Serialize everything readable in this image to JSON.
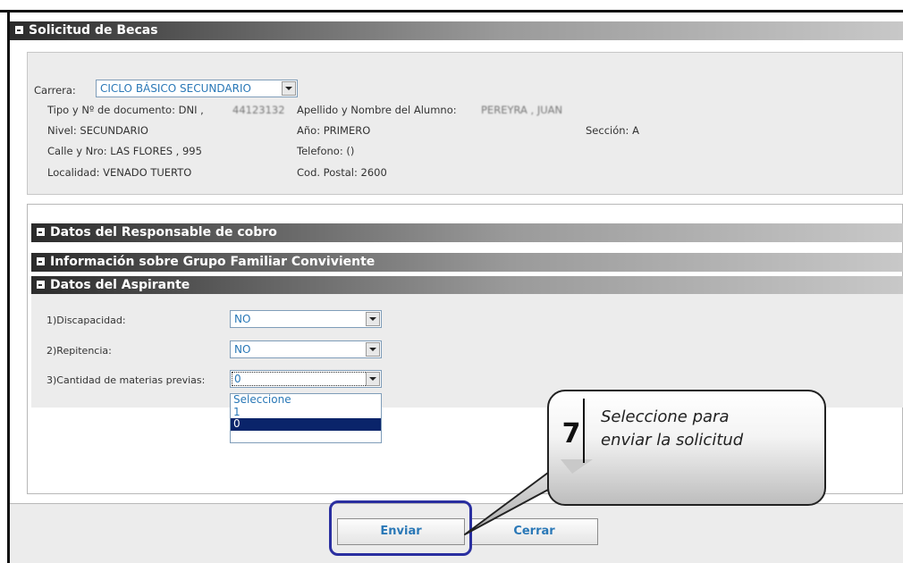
{
  "window": {
    "title": "Solicitud de Becas"
  },
  "student": {
    "carrera_label": "Carrera:",
    "carrera_value": "CICLO BÁSICO SECUNDARIO",
    "doc_label": "Tipo y Nº de documento: DNI ,",
    "doc_number": "44123132",
    "name_label": "Apellido y Nombre del Alumno:",
    "name_value": "PEREYRA , JUAN",
    "nivel": "Nivel: SECUNDARIO",
    "anio": "Año: PRIMERO",
    "seccion": "Sección: A",
    "calle": "Calle y Nro: LAS FLORES , 995",
    "telefono": "Telefono: ()",
    "localidad": "Localidad: VENADO TUERTO",
    "cod_postal": "Cod. Postal: 2600"
  },
  "sections": {
    "responsable": "Datos del Responsable de cobro",
    "grupo_familiar": "Información sobre Grupo Familiar Conviviente",
    "aspirante": "Datos del Aspirante"
  },
  "aspirante": {
    "discapacidad_label": "1)Discapacidad:",
    "discapacidad_value": "NO",
    "repitencia_label": "2)Repitencia:",
    "repitencia_value": "NO",
    "materias_label": "3)Cantidad de materias previas:",
    "materias_value": "0",
    "materias_options": [
      "Seleccione",
      "1",
      "0"
    ]
  },
  "buttons": {
    "enviar": "Enviar",
    "cerrar": "Cerrar"
  },
  "callout": {
    "step": "7",
    "line1": "Seleccione para",
    "line2": "enviar la solicitud"
  },
  "colors": {
    "highlight": "#2a2fa0",
    "link_blue": "#2a78b7",
    "selected_option": "#0a246a"
  }
}
